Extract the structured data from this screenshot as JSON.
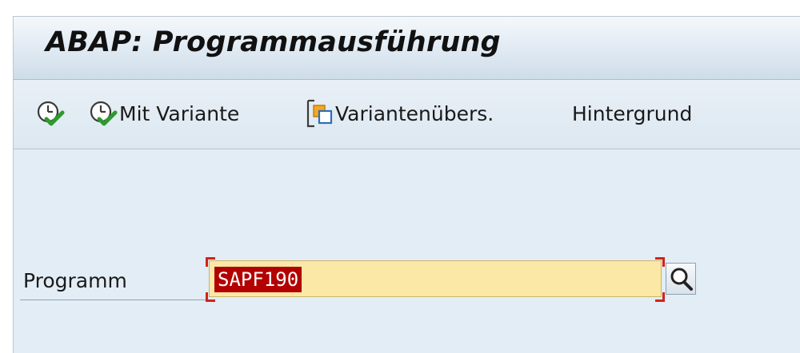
{
  "window": {
    "title": "ABAP: Programmausführung"
  },
  "toolbar": {
    "execute_icon": "execute-icon",
    "with_variant_label": "Mit Variante",
    "with_variant_icon": "execute-variant-icon",
    "variant_overview_label": "Variantenübers.",
    "variant_overview_icon": "variant-overview-icon",
    "background_label": "Hintergrund"
  },
  "form": {
    "program_label": "Programm",
    "program_value": "SAPF190",
    "search_help_icon": "magnifier-icon"
  },
  "colors": {
    "window_bg": "#e3edf5",
    "field_bg": "#fbe8a6",
    "selection_bg": "#b30000",
    "required_marker": "#d2231a",
    "check_green": "#2e9a2e"
  }
}
